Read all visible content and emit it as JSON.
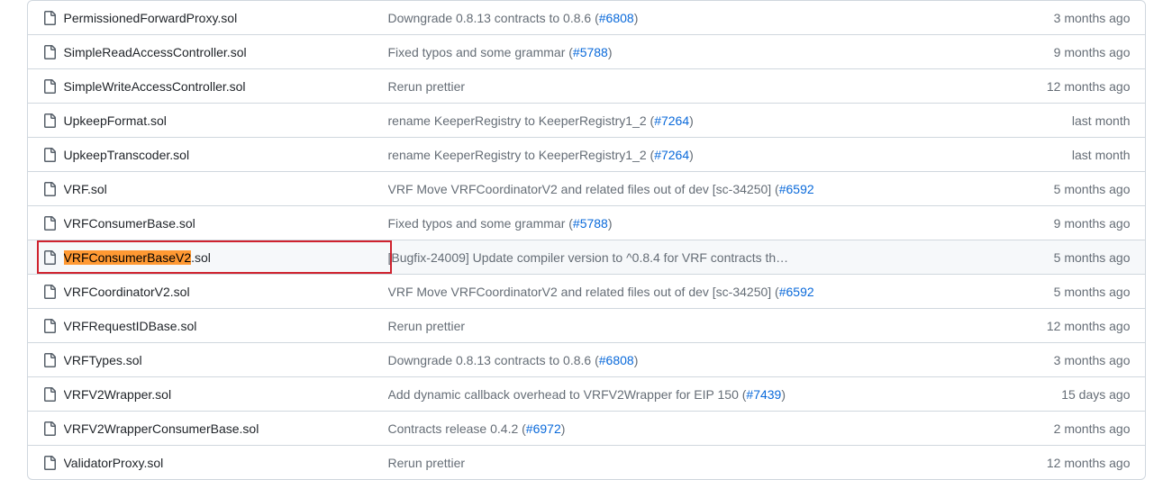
{
  "files": [
    {
      "name": "PermissionedForwardProxy.sol",
      "msg_pre": "Downgrade 0.8.13 contracts to 0.8.6 (",
      "issue": "#6808",
      "msg_post": ")",
      "age": "3 months ago",
      "highlight": false,
      "highlight_part": ""
    },
    {
      "name": "SimpleReadAccessController.sol",
      "msg_pre": "Fixed typos and some grammar (",
      "issue": "#5788",
      "msg_post": ")",
      "age": "9 months ago",
      "highlight": false,
      "highlight_part": ""
    },
    {
      "name": "SimpleWriteAccessController.sol",
      "msg_pre": "Rerun prettier",
      "issue": "",
      "msg_post": "",
      "age": "12 months ago",
      "highlight": false,
      "highlight_part": ""
    },
    {
      "name": "UpkeepFormat.sol",
      "msg_pre": "rename KeeperRegistry to KeeperRegistry1_2 (",
      "issue": "#7264",
      "msg_post": ")",
      "age": "last month",
      "highlight": false,
      "highlight_part": ""
    },
    {
      "name": "UpkeepTranscoder.sol",
      "msg_pre": "rename KeeperRegistry to KeeperRegistry1_2 (",
      "issue": "#7264",
      "msg_post": ")",
      "age": "last month",
      "highlight": false,
      "highlight_part": ""
    },
    {
      "name": "VRF.sol",
      "msg_pre": "VRF Move VRFCoordinatorV2 and related files out of dev [sc-34250] (",
      "issue": "#6592",
      "msg_post": "",
      "age": "5 months ago",
      "highlight": false,
      "highlight_part": ""
    },
    {
      "name": "VRFConsumerBase.sol",
      "msg_pre": "Fixed typos and some grammar (",
      "issue": "#5788",
      "msg_post": ")",
      "age": "9 months ago",
      "highlight": false,
      "highlight_part": ""
    },
    {
      "name": ".sol",
      "msg_pre": "[Bugfix-24009] Update compiler version to ^0.8.4 for VRF contracts th…",
      "issue": "",
      "msg_post": "",
      "age": "5 months ago",
      "highlight": true,
      "highlight_part": "VRFConsumerBaseV2"
    },
    {
      "name": "VRFCoordinatorV2.sol",
      "msg_pre": "VRF Move VRFCoordinatorV2 and related files out of dev [sc-34250] (",
      "issue": "#6592",
      "msg_post": "",
      "age": "5 months ago",
      "highlight": false,
      "highlight_part": ""
    },
    {
      "name": "VRFRequestIDBase.sol",
      "msg_pre": "Rerun prettier",
      "issue": "",
      "msg_post": "",
      "age": "12 months ago",
      "highlight": false,
      "highlight_part": ""
    },
    {
      "name": "VRFTypes.sol",
      "msg_pre": "Downgrade 0.8.13 contracts to 0.8.6 (",
      "issue": "#6808",
      "msg_post": ")",
      "age": "3 months ago",
      "highlight": false,
      "highlight_part": ""
    },
    {
      "name": "VRFV2Wrapper.sol",
      "msg_pre": "Add dynamic callback overhead to VRFV2Wrapper for EIP 150 (",
      "issue": "#7439",
      "msg_post": ")",
      "age": "15 days ago",
      "highlight": false,
      "highlight_part": ""
    },
    {
      "name": "VRFV2WrapperConsumerBase.sol",
      "msg_pre": "Contracts release 0.4.2 (",
      "issue": "#6972",
      "msg_post": ")",
      "age": "2 months ago",
      "highlight": false,
      "highlight_part": ""
    },
    {
      "name": "ValidatorProxy.sol",
      "msg_pre": "Rerun prettier",
      "issue": "",
      "msg_post": "",
      "age": "12 months ago",
      "highlight": false,
      "highlight_part": ""
    }
  ]
}
